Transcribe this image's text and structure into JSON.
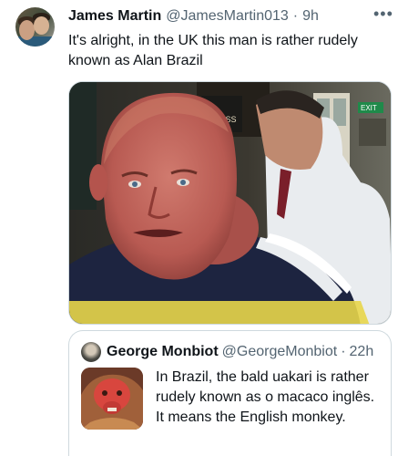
{
  "tweet": {
    "author_name": "James Martin",
    "author_handle": "@JamesMartin013",
    "separator": "·",
    "time": "9h",
    "more_icon": "more-horizontal-icon",
    "text": "It's alright, in the UK this man is rather rudely known as Alan Brazil",
    "media": {
      "description_icon": "photo",
      "sign_text": "INNESS",
      "exit_sign_text": "EXIT"
    }
  },
  "quoted_tweet": {
    "author_name": "George Monbiot",
    "author_handle": "@GeorgeMonbiot",
    "separator": "·",
    "time": "22h",
    "text": "In Brazil, the bald uakari is rather rudely known as o macaco inglês. It means the English monkey."
  },
  "colors": {
    "text_primary": "#0f1419",
    "text_secondary": "#536471",
    "border": "#cfd9de"
  }
}
